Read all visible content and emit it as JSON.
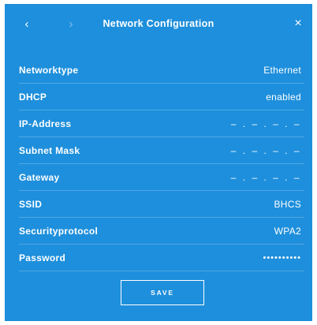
{
  "header": {
    "back_icon": "‹",
    "forward_icon": "›",
    "title": "Network Configuration",
    "close_icon": "×"
  },
  "rows": [
    {
      "label": "Networktype",
      "value": "Ethernet"
    },
    {
      "label": "DHCP",
      "value": "enabled"
    },
    {
      "label": "IP-Address",
      "value": "– . – . – . –"
    },
    {
      "label": "Subnet Mask",
      "value": "– . – . – . –"
    },
    {
      "label": "Gateway",
      "value": "– . – . – . –"
    },
    {
      "label": "SSID",
      "value": "BHCS"
    },
    {
      "label": "Securityprotocol",
      "value": "WPA2"
    },
    {
      "label": "Password",
      "value": "••••••••••"
    }
  ],
  "footer": {
    "save_label": "SAVE"
  },
  "colors": {
    "panel_background": "#1e8fdc",
    "text": "#ffffff"
  }
}
